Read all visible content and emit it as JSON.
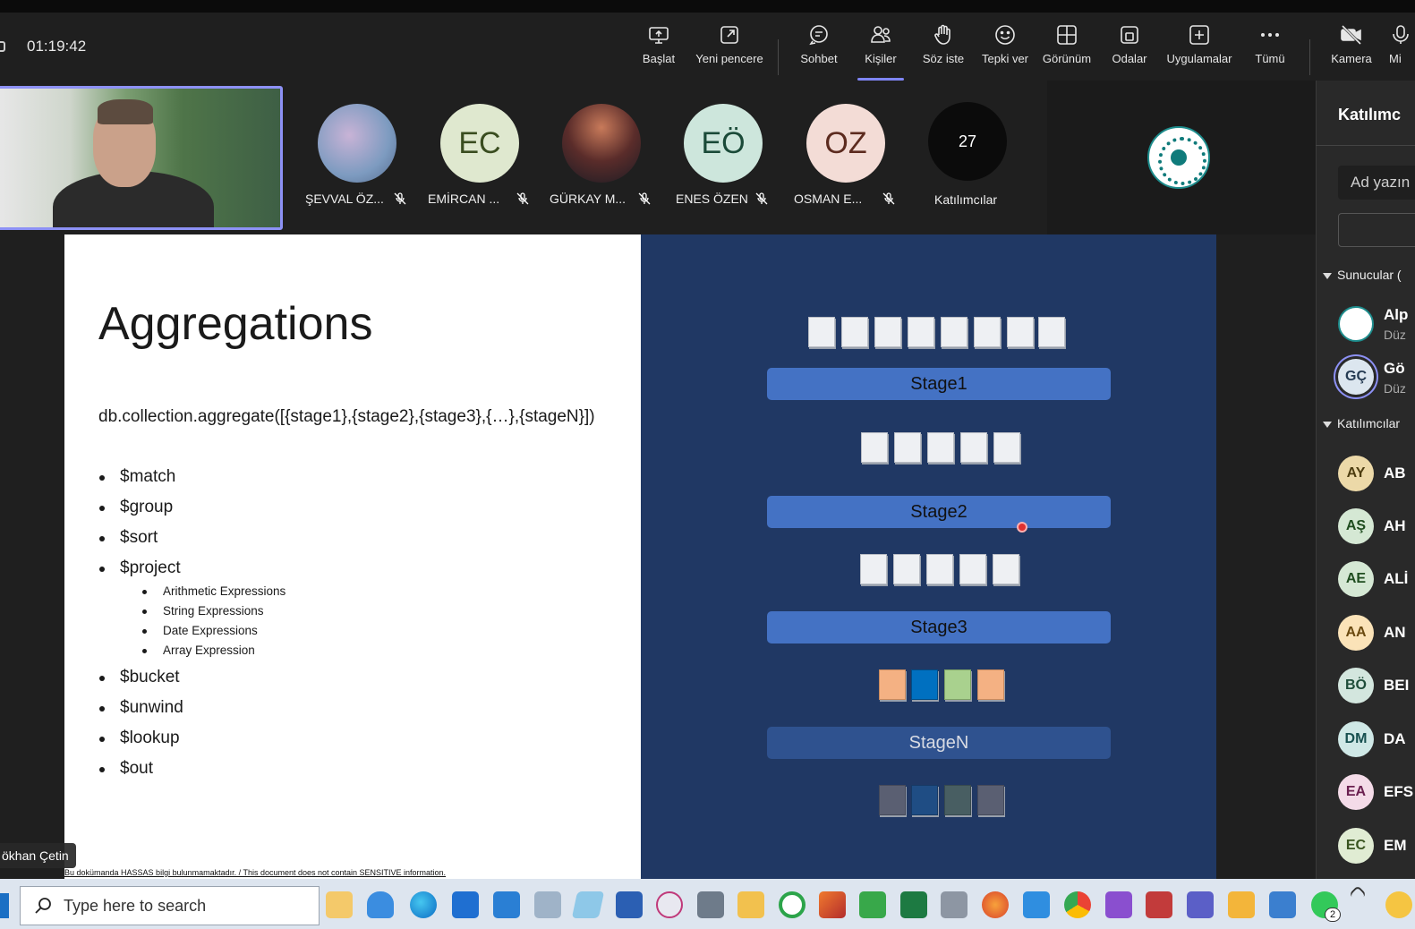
{
  "meeting": {
    "timer": "01:19:42"
  },
  "toolbar": {
    "items": [
      {
        "label": "Başlat",
        "icon": "share-screen-icon"
      },
      {
        "label": "Yeni pencere",
        "icon": "new-window-icon"
      },
      {
        "label": "Sohbet",
        "icon": "chat-icon"
      },
      {
        "label": "Kişiler",
        "icon": "people-icon",
        "active": true
      },
      {
        "label": "Söz iste",
        "icon": "raise-hand-icon"
      },
      {
        "label": "Tepki ver",
        "icon": "emoji-icon"
      },
      {
        "label": "Görünüm",
        "icon": "grid-view-icon"
      },
      {
        "label": "Odalar",
        "icon": "rooms-icon"
      },
      {
        "label": "Uygulamalar",
        "icon": "apps-plus-icon"
      },
      {
        "label": "Tümü",
        "icon": "more-icon"
      },
      {
        "label": "Kamera",
        "icon": "camera-off-icon"
      },
      {
        "label": "Mi",
        "icon": "mic-icon"
      }
    ]
  },
  "participants_strip": [
    {
      "name": "ŞEVVAL ÖZ...",
      "initials": "",
      "muted": true
    },
    {
      "name": "EMİRCAN ...",
      "initials": "EC",
      "muted": true
    },
    {
      "name": "GÜRKAY M...",
      "initials": "",
      "muted": true
    },
    {
      "name": "ENES ÖZEN",
      "initials": "EÖ",
      "muted": true
    },
    {
      "name": "OSMAN E...",
      "initials": "OZ",
      "muted": true
    }
  ],
  "overflow": {
    "count": "27",
    "label": "Katılımcılar"
  },
  "speaker": {
    "name": "ökhan Çetin"
  },
  "slide": {
    "title": "Aggregations",
    "aggregate_line": "db.collection.aggregate([{stage1},{stage2},{stage3},{…},{stageN}])",
    "bullets_a": [
      "$match",
      "$group",
      "$sort",
      "$project"
    ],
    "sub_bullets": [
      "Arithmetic Expressions",
      "String Expressions",
      "Date Expressions",
      "Array Expression"
    ],
    "bullets_b": [
      "$bucket",
      "$unwind",
      "$lookup",
      "$out"
    ],
    "stages": [
      "Stage1",
      "Stage2",
      "Stage3",
      "StageN"
    ],
    "footnote": "Bu dokümanda HASSAS bilgi bulunmamaktadır. / This document does not contain SENSITIVE information."
  },
  "panel": {
    "title": "Katılımc",
    "search_placeholder": "Ad yazın",
    "presenters_label": "Sunucular (",
    "attendees_label": "Katılımcılar",
    "presenters": [
      {
        "initials": "",
        "name": "Alp",
        "sub": "Düz"
      },
      {
        "initials": "GÇ",
        "name": "Gö",
        "sub": "Düz"
      }
    ],
    "attendees": [
      {
        "initials": "AY",
        "name": "AB",
        "color": "#ecd9a8",
        "fg": "#4d3d10"
      },
      {
        "initials": "AŞ",
        "name": "AH",
        "color": "#d5e8d4",
        "fg": "#1f4d1f"
      },
      {
        "initials": "AE",
        "name": "ALİ",
        "color": "#d5e8d4",
        "fg": "#1f4d1f"
      },
      {
        "initials": "AA",
        "name": "AN",
        "color": "#fbe3b8",
        "fg": "#6b4a10"
      },
      {
        "initials": "BÖ",
        "name": "BEI",
        "color": "#d3e6de",
        "fg": "#1f4d3a"
      },
      {
        "initials": "DM",
        "name": "DA",
        "color": "#cfe8e6",
        "fg": "#175050"
      },
      {
        "initials": "EA",
        "name": "EFS",
        "color": "#f4dbe8",
        "fg": "#6b2050"
      },
      {
        "initials": "EC",
        "name": "EM",
        "color": "#e0ecd3",
        "fg": "#3a5520"
      }
    ]
  },
  "taskbar": {
    "search_placeholder": "Type here to search",
    "whatsapp_badge": "2"
  }
}
